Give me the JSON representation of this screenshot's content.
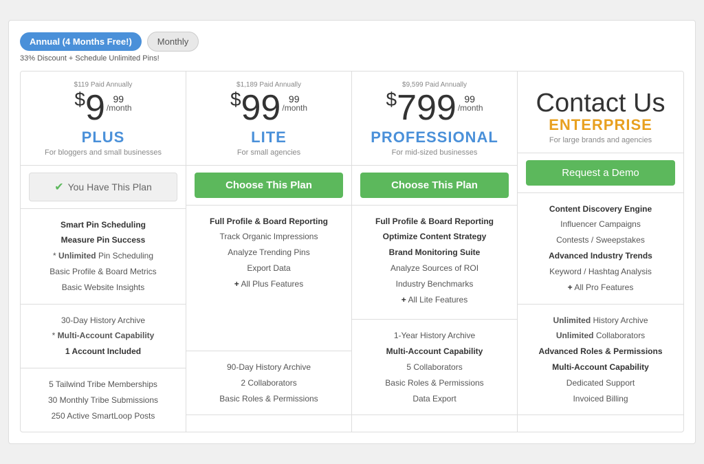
{
  "billing": {
    "annual_label": "Annual (4 Months Free!)",
    "monthly_label": "Monthly",
    "discount_text": "33% Discount + Schedule Unlimited Pins!"
  },
  "plans": [
    {
      "id": "plus",
      "annual_note": "$119 Paid Annually",
      "price_dollar": "$",
      "price_amount": "9",
      "price_super": "99",
      "price_period": "/month",
      "name": "PLUS",
      "name_style": "blue",
      "tagline": "For bloggers and small businesses",
      "cta_type": "has_plan",
      "cta_label": "You Have This Plan",
      "features": [
        {
          "text": "Smart Pin Scheduling",
          "bold": true
        },
        {
          "text": "Measure Pin Success",
          "bold": true
        },
        {
          "text": "* Unlimited Pin Scheduling",
          "bold": false,
          "star": true
        },
        {
          "text": "Basic Profile & Board Metrics",
          "bold": false
        },
        {
          "text": "Basic Website Insights",
          "bold": false
        }
      ],
      "history": [
        {
          "text": "30-Day History Archive",
          "bold": false
        },
        {
          "text": "* Multi-Account Capability",
          "bold": true,
          "star": true
        },
        {
          "text": "1 Account Included",
          "bold": true
        }
      ],
      "extras": [
        {
          "text": "5 Tailwind Tribe Memberships"
        },
        {
          "text": "30 Monthly Tribe Submissions"
        },
        {
          "text": "250 Active SmartLoop Posts"
        }
      ]
    },
    {
      "id": "lite",
      "annual_note": "$1,189 Paid Annually",
      "price_dollar": "$",
      "price_amount": "99",
      "price_super": "99",
      "price_period": "/month",
      "name": "LITE",
      "name_style": "blue",
      "tagline": "For small agencies",
      "cta_type": "choose",
      "cta_label": "Choose This Plan",
      "features": [
        {
          "text": "Full Profile & Board Reporting",
          "bold": true
        },
        {
          "text": "Track Organic Impressions",
          "bold": false
        },
        {
          "text": "Analyze Trending Pins",
          "bold": false
        },
        {
          "text": "Export Data",
          "bold": false
        },
        {
          "text": "+ All Plus Features",
          "bold": false,
          "plus": true
        }
      ],
      "history": [
        {
          "text": "90-Day History Archive",
          "bold": false
        },
        {
          "text": "2 Collaborators",
          "bold": false
        },
        {
          "text": "Basic Roles & Permissions",
          "bold": false
        }
      ],
      "extras": []
    },
    {
      "id": "professional",
      "annual_note": "$9,599 Paid Annually",
      "price_dollar": "$",
      "price_amount": "799",
      "price_super": "99",
      "price_period": "/month",
      "name": "PROFESSIONAL",
      "name_style": "blue",
      "tagline": "For mid-sized businesses",
      "cta_type": "choose",
      "cta_label": "Choose This Plan",
      "features": [
        {
          "text": "Full Profile & Board Reporting",
          "bold": true
        },
        {
          "text": "Optimize Content Strategy",
          "bold": true
        },
        {
          "text": "Brand Monitoring Suite",
          "bold": true
        },
        {
          "text": "Analyze Sources of ROI",
          "bold": false
        },
        {
          "text": "Industry Benchmarks",
          "bold": false
        },
        {
          "text": "+ All Lite Features",
          "bold": false,
          "plus": true
        }
      ],
      "history": [
        {
          "text": "1-Year History Archive",
          "bold": false
        },
        {
          "text": "Multi-Account Capability",
          "bold": true
        },
        {
          "text": "5 Collaborators",
          "bold": false
        },
        {
          "text": "Basic Roles & Permissions",
          "bold": false
        },
        {
          "text": "Data Export",
          "bold": false
        }
      ],
      "extras": []
    },
    {
      "id": "enterprise",
      "annual_note": "",
      "price_dollar": "",
      "price_amount": "",
      "price_super": "",
      "price_period": "",
      "title": "Contact Us",
      "name": "ENTERPRISE",
      "name_style": "gold",
      "tagline": "For large brands and agencies",
      "cta_type": "demo",
      "cta_label": "Request a Demo",
      "features": [
        {
          "text": "Content Discovery Engine",
          "bold": true
        },
        {
          "text": "Influencer Campaigns",
          "bold": false
        },
        {
          "text": "Contests / Sweepstakes",
          "bold": false
        },
        {
          "text": "Advanced Industry Trends",
          "bold": true
        },
        {
          "text": "Keyword / Hashtag Analysis",
          "bold": false
        },
        {
          "text": "+ All Pro Features",
          "bold": false,
          "plus": true
        }
      ],
      "history": [
        {
          "text": "Unlimited History Archive",
          "bold": true,
          "prefix": "Unlimited "
        },
        {
          "text": "Unlimited Collaborators",
          "bold": true,
          "prefix": "Unlimited "
        },
        {
          "text": "Advanced Roles & Permissions",
          "bold": true
        },
        {
          "text": "Multi-Account Capability",
          "bold": true
        },
        {
          "text": "Dedicated Support",
          "bold": false
        },
        {
          "text": "Invoiced Billing",
          "bold": false
        }
      ],
      "extras": []
    }
  ]
}
